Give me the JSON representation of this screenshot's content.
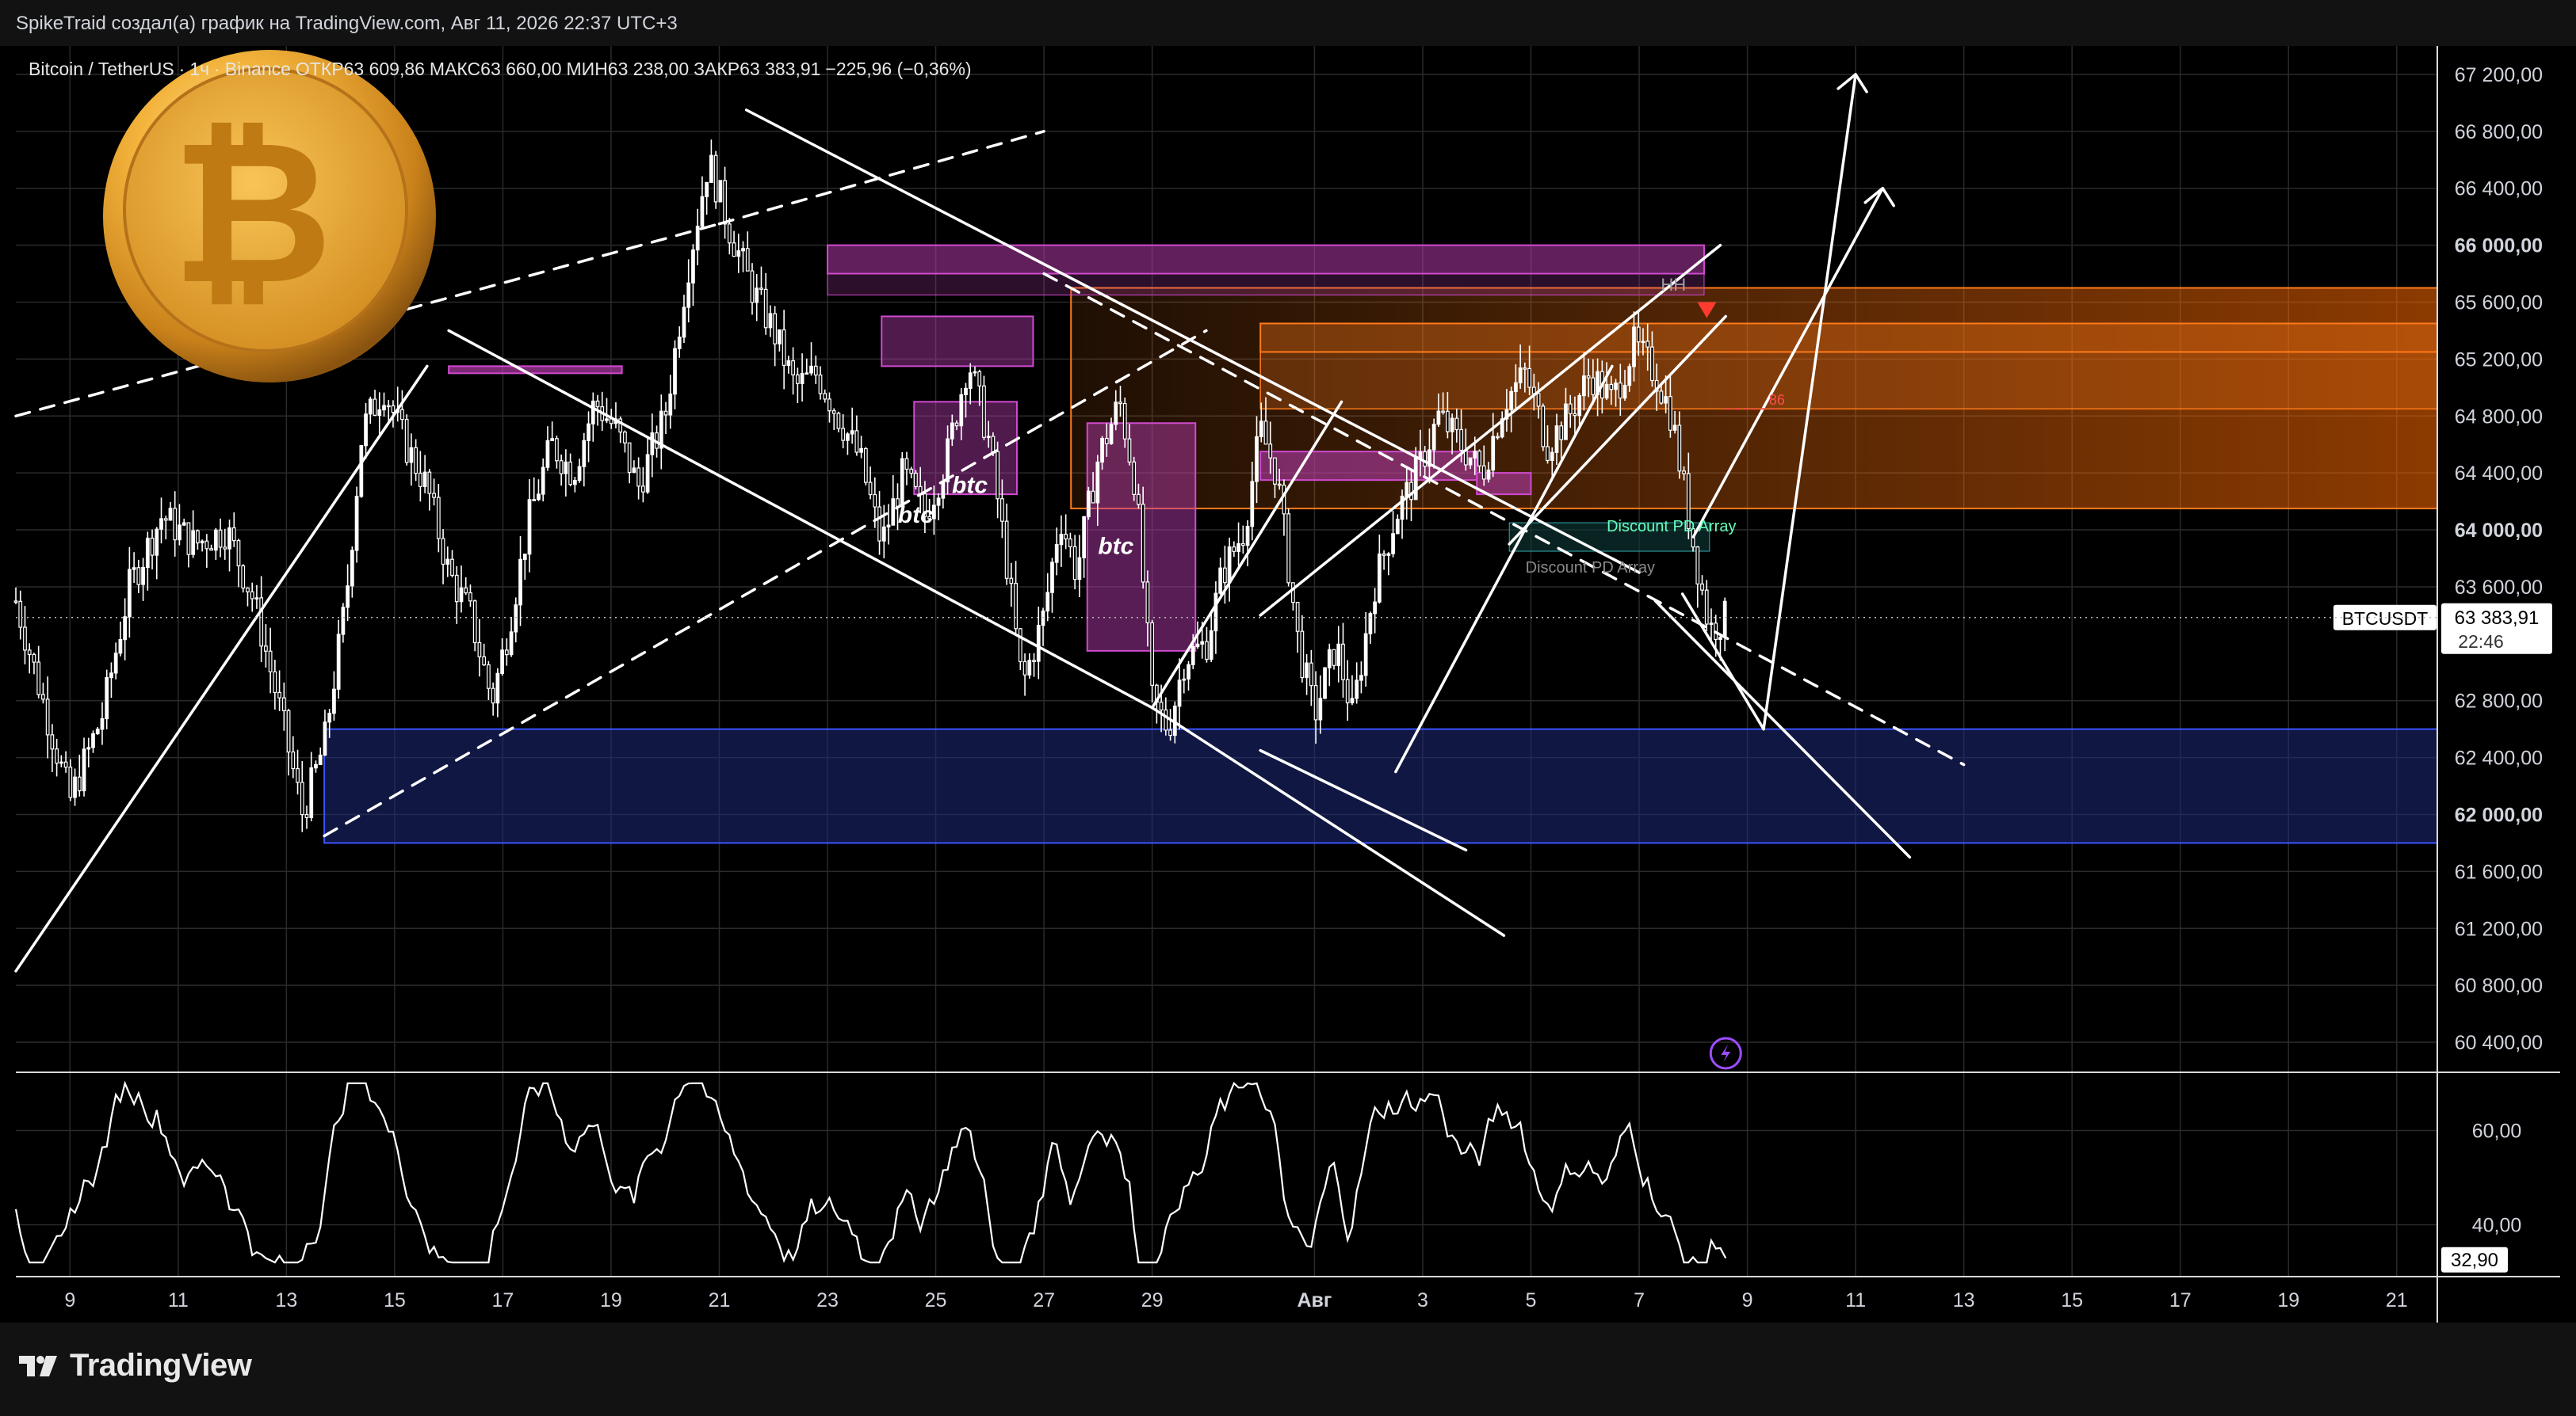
{
  "attribution": "SpikeTraid создал(а) график на TradingView.com, Авг 11, 2026 22:37 UTC+3",
  "legend": {
    "symbol": "Bitcoin / TetherUS",
    "interval": "1ч",
    "exchange": "Binance",
    "open": "ОТКР63 609,86",
    "high": "МАКС63 660,00",
    "low": "МИН63 238,00",
    "close": "ЗАКР63 383,91",
    "change": "−225,96 (−0,36%)"
  },
  "price_tag": {
    "symbol": "BTCUSDT",
    "price": "63 383,91",
    "countdown": "22:46"
  },
  "osc_tag": "32,90",
  "brand": {
    "logo_text": "TradingView",
    "accent": "#2962ff",
    "dark_bg": "#121212"
  },
  "annotations": {
    "hh": "HH",
    "discount1": "Discount PD Array",
    "discount2": "Discount PD Array",
    "btc1": "btc",
    "btc2": "btc",
    "btc3": "btc",
    "level": "86"
  },
  "chart_data": [
    {
      "type": "candlestick",
      "symbol": "BTCUSDT",
      "ylim": [
        60200,
        67400
      ],
      "y_ticks": [
        "67 200,00",
        "66 800,00",
        "66 400,00",
        "66 000,00",
        "65 600,00",
        "65 200,00",
        "64 800,00",
        "64 400,00",
        "64 000,00",
        "63 600,00",
        "62 800,00",
        "62 400,00",
        "62 000,00",
        "61 600,00",
        "61 200,00",
        "60 800,00",
        "60 400,00"
      ],
      "x_ticks": [
        "9",
        "11",
        "13",
        "15",
        "17",
        "19",
        "21",
        "23",
        "25",
        "27",
        "29",
        "Авг",
        "3",
        "5",
        "7",
        "9",
        "11",
        "13",
        "15",
        "17",
        "19",
        "21"
      ],
      "x_range_days": [
        8,
        22.75
      ],
      "close_anchors": [
        [
          8.0,
          63500
        ],
        [
          8.5,
          62800
        ],
        [
          9.0,
          62100
        ],
        [
          9.6,
          62700
        ],
        [
          10.1,
          63600
        ],
        [
          10.7,
          64100
        ],
        [
          11.3,
          63900
        ],
        [
          11.9,
          64000
        ],
        [
          12.4,
          63500
        ],
        [
          12.9,
          62700
        ],
        [
          13.3,
          62000
        ],
        [
          13.7,
          62500
        ],
        [
          14.1,
          63500
        ],
        [
          14.4,
          64700
        ],
        [
          14.8,
          65000
        ],
        [
          15.2,
          64600
        ],
        [
          15.6,
          64300
        ],
        [
          16.0,
          63700
        ],
        [
          16.4,
          63400
        ],
        [
          16.8,
          62800
        ],
        [
          17.1,
          63300
        ],
        [
          17.5,
          64100
        ],
        [
          17.9,
          64600
        ],
        [
          18.3,
          64400
        ],
        [
          18.7,
          64900
        ],
        [
          19.1,
          64700
        ],
        [
          19.5,
          64300
        ],
        [
          20.0,
          64800
        ],
        [
          20.4,
          65800
        ],
        [
          20.8,
          66600
        ],
        [
          21.2,
          66100
        ],
        [
          21.6,
          65700
        ],
        [
          22.0,
          65400
        ],
        [
          22.4,
          65000
        ],
        [
          22.8,
          65100
        ],
        [
          23.2,
          64800
        ],
        [
          23.6,
          64500
        ],
        [
          24.0,
          63900
        ],
        [
          24.4,
          64400
        ],
        [
          24.8,
          64100
        ],
        [
          25.2,
          64500
        ],
        [
          25.6,
          65200
        ],
        [
          26.0,
          64600
        ],
        [
          26.3,
          63800
        ],
        [
          26.6,
          62900
        ],
        [
          27.0,
          63400
        ],
        [
          27.3,
          64100
        ],
        [
          27.6,
          63700
        ],
        [
          28.0,
          64500
        ],
        [
          28.4,
          64900
        ],
        [
          28.7,
          64300
        ],
        [
          29.0,
          62800
        ],
        [
          29.3,
          62600
        ],
        [
          29.6,
          63100
        ],
        [
          30.0,
          63200
        ],
        [
          30.3,
          63700
        ],
        [
          30.7,
          64000
        ],
        [
          31.0,
          64700
        ],
        [
          31.3,
          64400
        ],
        [
          31.7,
          63200
        ],
        [
          32.0,
          62700
        ],
        [
          32.4,
          63200
        ],
        [
          32.7,
          62700
        ],
        [
          33.1,
          63600
        ],
        [
          33.5,
          64100
        ],
        [
          33.9,
          64400
        ],
        [
          34.3,
          64800
        ],
        [
          34.7,
          64600
        ],
        [
          35.1,
          64400
        ],
        [
          35.5,
          64900
        ],
        [
          35.9,
          65100
        ],
        [
          36.3,
          64600
        ],
        [
          36.7,
          64800
        ],
        [
          37.1,
          65100
        ],
        [
          37.5,
          64900
        ],
        [
          37.9,
          65300
        ],
        [
          38.3,
          65100
        ],
        [
          38.6,
          64800
        ],
        [
          39.0,
          63900
        ],
        [
          39.3,
          63300
        ],
        [
          39.6,
          63380
        ]
      ],
      "candle_width_days": 0.042
    },
    {
      "type": "line",
      "name": "oscillator",
      "ylim": [
        29,
        72
      ],
      "y_ticks": [
        "60,00",
        "40,00"
      ],
      "last": 32.9
    }
  ],
  "colors": {
    "bull_candle": "#ffffff",
    "bear_candle": "#000000",
    "grid": "#2a2a2a",
    "blue_zone": "#1e2a78",
    "orange_zone": "#ff7a1a",
    "magenta_zone": "#b03aa8",
    "trendline": "#ffffff",
    "red_marker": "#ff3b30"
  }
}
